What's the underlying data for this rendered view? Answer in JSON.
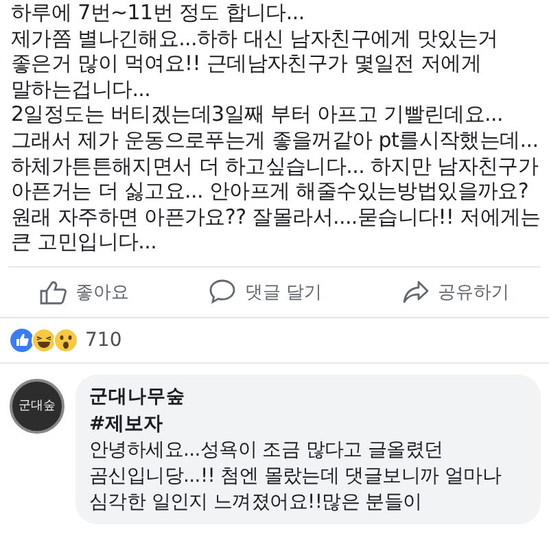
{
  "post": {
    "lines": [
      "하루에 7번~11번 정도 합니다...",
      "제가쫌 별나긴해요...하하 대신 남자친구에게 맛있는거",
      "좋은거 많이 먹여요!!  근데남자친구가 몇일전 저에게",
      "말하는겁니다...",
      "2일정도는 버티겠는데3일째 부터 아프고 기빨린데요...",
      "그래서 제가 운동으로푸는게 좋을꺼같아 pt를시작했는데...",
      "하체가튼튼해지면서  더 하고싶습니다... 하지만 남자친구가",
      "아픈거는 더 싫고요... 안아프게 해줄수있는방법있을까요?",
      "원래 자주하면 아픈가요?? 잘몰라서....묻습니다!! 저에게는",
      "큰 고민입니다..."
    ]
  },
  "actions": [
    {
      "kind": "like",
      "label": "좋아요"
    },
    {
      "kind": "comment",
      "label": "댓글 달기"
    },
    {
      "kind": "share",
      "label": "공유하기"
    }
  ],
  "reactions": {
    "icons": [
      {
        "kind": "like"
      },
      {
        "kind": "haha"
      },
      {
        "kind": "wow"
      }
    ],
    "count": "710"
  },
  "comment": {
    "avatar_text": "군대숲",
    "author": "군대나무숲",
    "tag": "#제보자",
    "lines": [
      "안녕하세요...성욕이 조금 많다고 글올렸던",
      "곰신입니당...!! 첨엔 몰랐는데 댓글보니까 얼마나",
      "심각한 일인지 느껴졌어요!!많은 분들이"
    ]
  }
}
